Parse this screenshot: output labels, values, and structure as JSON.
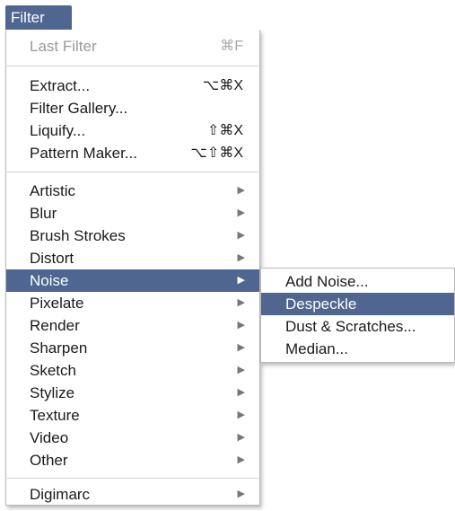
{
  "menu_title": "Filter",
  "colors": {
    "highlight": "#4e6690",
    "disabled_text": "#9a9a9a"
  },
  "items": [
    {
      "label": "Last Filter",
      "shortcut": "⌘F",
      "disabled": true
    },
    {
      "label": "Extract...",
      "shortcut": "⌥⌘X"
    },
    {
      "label": "Filter Gallery...",
      "shortcut": ""
    },
    {
      "label": "Liquify...",
      "shortcut": "⇧⌘X"
    },
    {
      "label": "Pattern Maker...",
      "shortcut": "⌥⇧⌘X"
    },
    {
      "label": "Artistic",
      "submenu_indicator": "▶"
    },
    {
      "label": "Blur",
      "submenu_indicator": "▶"
    },
    {
      "label": "Brush Strokes",
      "submenu_indicator": "▶"
    },
    {
      "label": "Distort",
      "submenu_indicator": "▶"
    },
    {
      "label": "Noise",
      "submenu_indicator": "▶",
      "highlighted": true
    },
    {
      "label": "Pixelate",
      "submenu_indicator": "▶"
    },
    {
      "label": "Render",
      "submenu_indicator": "▶"
    },
    {
      "label": "Sharpen",
      "submenu_indicator": "▶"
    },
    {
      "label": "Sketch",
      "submenu_indicator": "▶"
    },
    {
      "label": "Stylize",
      "submenu_indicator": "▶"
    },
    {
      "label": "Texture",
      "submenu_indicator": "▶"
    },
    {
      "label": "Video",
      "submenu_indicator": "▶"
    },
    {
      "label": "Other",
      "submenu_indicator": "▶"
    },
    {
      "label": "Digimarc",
      "submenu_indicator": "▶"
    }
  ],
  "submenu": {
    "items": [
      {
        "label": "Add Noise..."
      },
      {
        "label": "Despeckle",
        "highlighted": true
      },
      {
        "label": "Dust & Scratches..."
      },
      {
        "label": "Median..."
      }
    ]
  }
}
